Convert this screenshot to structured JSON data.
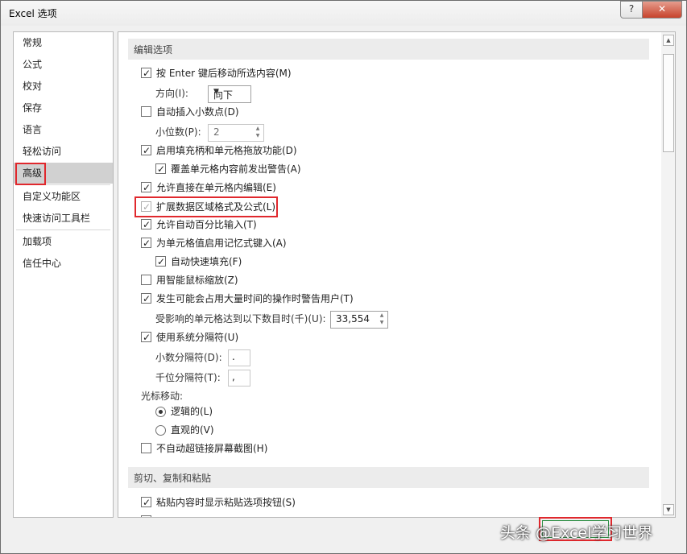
{
  "window": {
    "title": "Excel 选项",
    "help": "?",
    "close": "✕"
  },
  "nav": {
    "items": [
      "常规",
      "公式",
      "校对",
      "保存",
      "语言",
      "轻松访问",
      "高级",
      "自定义功能区",
      "快速访问工具栏",
      "加载项",
      "信任中心"
    ],
    "selected": "高级"
  },
  "edit_section": {
    "header": "编辑选项",
    "after_enter_move": "按 Enter 键后移动所选内容(M)",
    "direction_label": "方向(I):",
    "direction_value": "向下",
    "auto_decimal": "自动插入小数点(D)",
    "decimal_places_label": "小位数(P):",
    "decimal_places_value": "2",
    "fill_handle": "启用填充柄和单元格拖放功能(D)",
    "alert_overwrite": "覆盖单元格内容前发出警告(A)",
    "edit_in_cell": "允许直接在单元格内编辑(E)",
    "extend_formats": "扩展数据区域格式及公式(L)",
    "auto_percent": "允许自动百分比输入(T)",
    "autocomplete": "为单元格值启用记忆式键入(A)",
    "flash_fill": "自动快速填充(F)",
    "intellimouse_zoom": "用智能鼠标缩放(Z)",
    "alert_slow": "发生可能会占用大量时间的操作时警告用户(T)",
    "cells_affected_label": "受影响的单元格达到以下数目时(千)(U):",
    "cells_affected_value": "33,554",
    "system_separators": "使用系统分隔符(U)",
    "decimal_sep_label": "小数分隔符(D):",
    "decimal_sep_value": ".",
    "thousands_sep_label": "千位分隔符(T):",
    "thousands_sep_value": ",",
    "cursor_movement_label": "光标移动:",
    "logical": "逻辑的(L)",
    "visual": "直观的(V)",
    "no_hyperlink_screenshot": "不自动超链接屏幕截图(H)"
  },
  "paste_section": {
    "header": "剪切、复制和粘贴",
    "show_paste_options": "粘贴内容时显示粘贴选项按钮(S)"
  },
  "watermark": "头条 @Excel学习世界"
}
